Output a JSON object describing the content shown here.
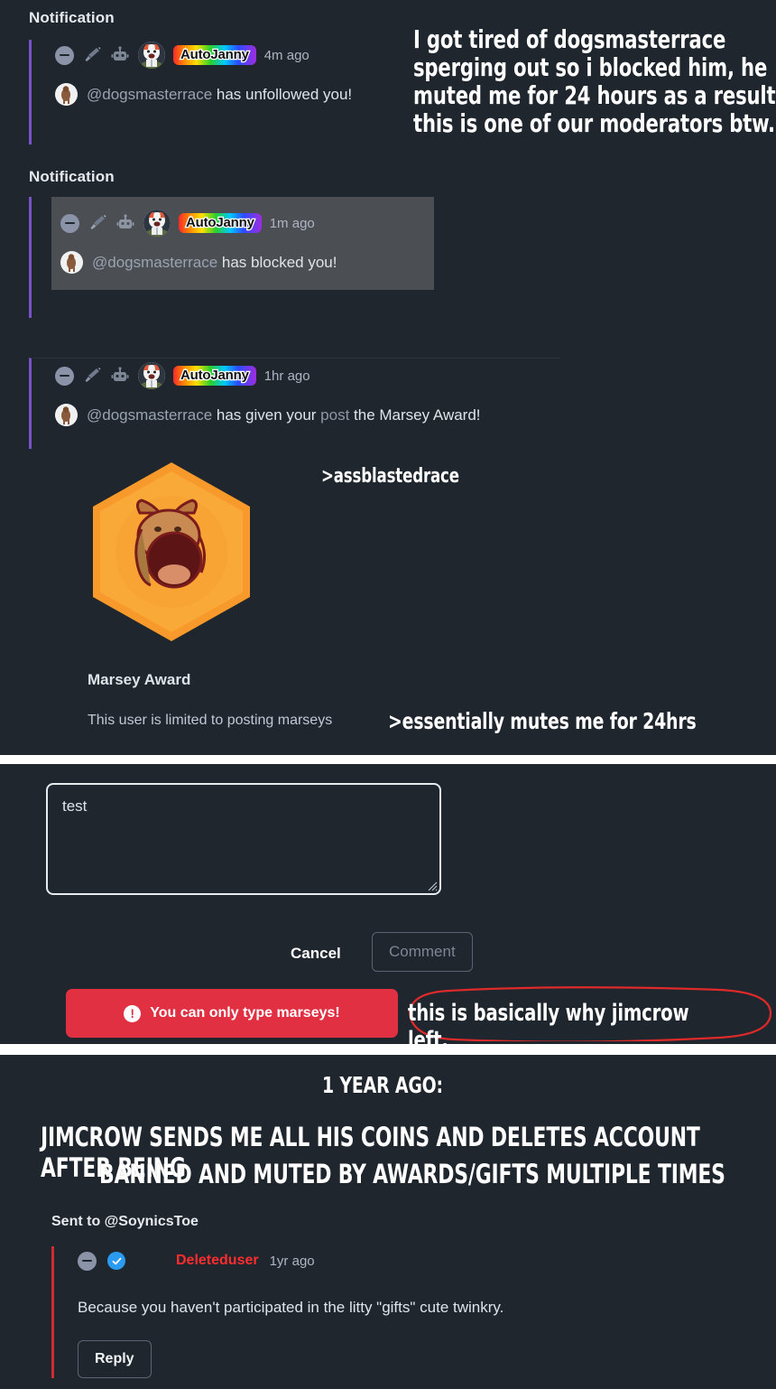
{
  "meta": {
    "bg_color": "#1f262e",
    "accent_purple": "#7a52c7",
    "accent_red": "#ff2d2d",
    "error_red": "#e03042",
    "highlight_gray": "#4b4e53"
  },
  "panel_notifications": {
    "groups": [
      {
        "label": "Notification",
        "actor": {
          "badge": "AutoJanny",
          "time": "4m ago",
          "icons": [
            "minus-circle-icon",
            "broom-icon",
            "robot-icon",
            "avatar"
          ]
        },
        "message_user": "@dogsmasterrace",
        "message_rest": " has unfollowed you!",
        "highlighted": false
      },
      {
        "label": "Notification",
        "actor": {
          "badge": "AutoJanny",
          "time": "1m ago",
          "icons": [
            "minus-circle-icon",
            "broom-icon",
            "robot-icon",
            "avatar"
          ]
        },
        "message_user": "@dogsmasterrace",
        "message_rest": " has blocked you!",
        "highlighted": true
      },
      {
        "label": "",
        "actor": {
          "badge": "AutoJanny",
          "time": "1hr ago",
          "icons": [
            "minus-circle-icon",
            "broom-icon",
            "robot-icon",
            "avatar"
          ]
        },
        "message_user": "@dogsmasterrace",
        "message_mid": " has given your ",
        "message_link": "post",
        "message_rest": " the Marsey Award!",
        "highlighted": false
      }
    ],
    "award": {
      "icon_name": "marsey-award-hexagon-icon",
      "title": "Marsey Award",
      "description": "This user is limited to posting marseys"
    },
    "annotations": {
      "top_caption": "I got tired of dogsmasterrace sperging out so i blocked him, he muted me for 24 hours as a result. this is one of our moderators btw.",
      "award_caption": ">assblastedrace",
      "mute_caption": ">essentially mutes me for 24hrs"
    }
  },
  "panel_composer": {
    "textarea_value": "test",
    "textarea_placeholder": "",
    "cancel_label": "Cancel",
    "comment_label": "Comment",
    "error_message": "You can only type marseys!",
    "error_icon": "exclamation-circle-icon",
    "annotation": "this is basically why jimcrow left."
  },
  "panel_history": {
    "heading_small": "1 YEAR AGO:",
    "heading_big_line1": "JIMCROW SENDS ME ALL HIS COINS AND DELETES ACCOUNT AFTER BEING",
    "heading_big_line2": "BANNED AND MUTED BY AWARDS/GIFTS MULTIPLE TIMES",
    "sent_to": "Sent to @SoynicsToe",
    "comment": {
      "username": "Deleteduser",
      "time": "1yr ago",
      "body": "Because you haven't participated in the litty \"gifts\" cute twinkry.",
      "reply_label": "Reply",
      "icons": [
        "minus-circle-icon",
        "verified-check-icon"
      ]
    }
  }
}
